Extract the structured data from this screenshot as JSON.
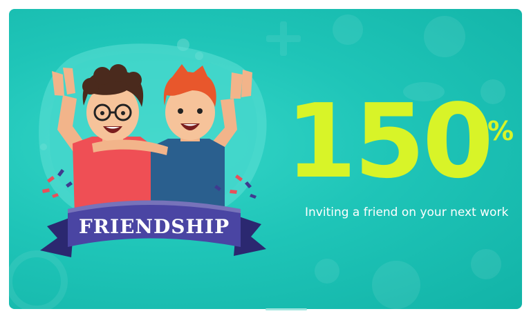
{
  "promo": {
    "number": "150",
    "percent_sign": "%",
    "subtitle": "Inviting a friend on your next work",
    "banner_text": "FRIENDSHIP"
  },
  "colors": {
    "background": "#1fc5b8",
    "accent": "#d8f428",
    "banner": "#3f3b8f",
    "text": "#ffffff"
  },
  "icons": [
    "friends-illustration-icon",
    "ribbon-banner-icon",
    "confetti-icon",
    "plus-decoration-icon"
  ]
}
